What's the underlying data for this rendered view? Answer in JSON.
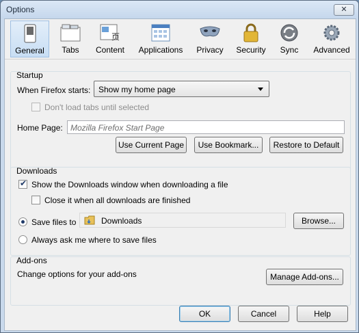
{
  "window": {
    "title": "Options",
    "close_glyph": "✕"
  },
  "toolbar": {
    "tabs": [
      {
        "label": "General",
        "icon": "switch-icon",
        "selected": true
      },
      {
        "label": "Tabs",
        "icon": "tabs-icon"
      },
      {
        "label": "Content",
        "icon": "content-icon"
      },
      {
        "label": "Applications",
        "icon": "applications-icon"
      },
      {
        "label": "Privacy",
        "icon": "mask-icon"
      },
      {
        "label": "Security",
        "icon": "padlock-icon"
      },
      {
        "label": "Sync",
        "icon": "sync-icon"
      },
      {
        "label": "Advanced",
        "icon": "gear-icon"
      }
    ]
  },
  "startup": {
    "title": "Startup",
    "when_starts_label": "When Firefox starts:",
    "when_starts_value": "Show my home page",
    "dont_load_tabs_label": "Don't load tabs until selected",
    "home_page_label": "Home Page:",
    "home_page_placeholder": "Mozilla Firefox Start Page",
    "use_current_label": "Use Current Page",
    "use_bookmark_label": "Use Bookmark...",
    "restore_default_label": "Restore to Default"
  },
  "downloads": {
    "title": "Downloads",
    "show_window_label": "Show the Downloads window when downloading a file",
    "show_window_checked": true,
    "close_it_label": "Close it when all downloads are finished",
    "save_files_label": "Save files to",
    "save_folder": "Downloads",
    "browse_label": "Browse...",
    "always_ask_label": "Always ask me where to save files"
  },
  "addons": {
    "title": "Add-ons",
    "description": "Change options for your add-ons",
    "manage_label": "Manage Add-ons..."
  },
  "footer": {
    "ok_label": "OK",
    "cancel_label": "Cancel",
    "help_label": "Help"
  }
}
